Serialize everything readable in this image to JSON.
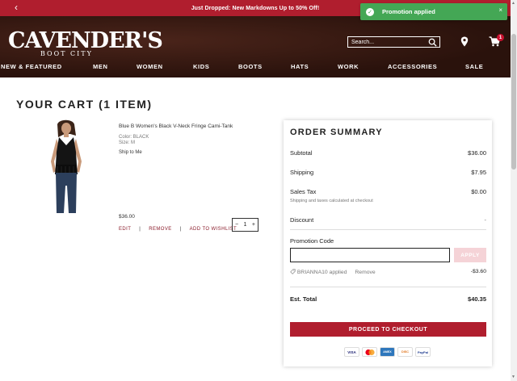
{
  "promo_bar": {
    "text": "Just Dropped: New Markdowns Up to 50% Off!",
    "back_icon": "chevron-left-icon"
  },
  "toast": {
    "text": "Promotion applied",
    "close": "×"
  },
  "header": {
    "logo_main": "CAVENDER'S",
    "logo_sub": "BOOT CITY",
    "search_placeholder": "Search...",
    "cart_count": "1",
    "nav": [
      "NEW & FEATURED",
      "MEN",
      "WOMEN",
      "KIDS",
      "BOOTS",
      "HATS",
      "WORK",
      "ACCESSORIES",
      "SALE"
    ]
  },
  "cart": {
    "title": "YOUR CART (1 ITEM)",
    "item": {
      "name": "Blue B Women's Black V-Neck Fringe Cami-Tank",
      "color": "Color: BLACK",
      "size": "Size: M",
      "ship": "Ship to Me",
      "price": "$36.00",
      "edit": "EDIT",
      "remove": "REMOVE",
      "wishlist": "ADD TO WISHLIST",
      "sep": "|",
      "qty": "1",
      "minus": "−",
      "plus": "+"
    }
  },
  "summary": {
    "title": "ORDER SUMMARY",
    "subtotal_label": "Subtotal",
    "subtotal": "$36.00",
    "shipping_label": "Shipping",
    "shipping": "$7.95",
    "tax_label": "Sales Tax",
    "tax": "$0.00",
    "tax_note": "Shipping and taxes calculated at checkout",
    "discount_label": "Discount",
    "discount": "-",
    "promo_label": "Promotion Code",
    "apply": "APPLY",
    "applied_code": "BRIANNA10 applied",
    "applied_remove": "Remove",
    "applied_amount": "-$3.60",
    "total_label": "Est. Total",
    "total": "$40.35",
    "checkout": "PROCEED TO CHECKOUT",
    "payments": [
      "VISA",
      "MC",
      "AMEX",
      "DISC",
      "PayPal"
    ]
  },
  "colors": {
    "brand_red": "#b01e2e",
    "toast_green": "#44a755",
    "header_brown": "#3a1a12"
  }
}
